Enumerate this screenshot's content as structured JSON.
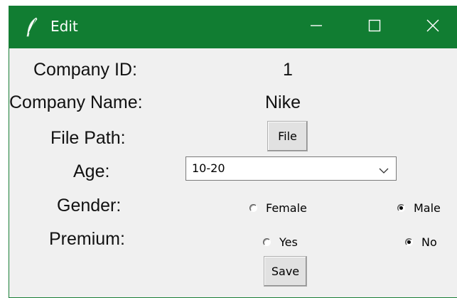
{
  "window": {
    "title": "Edit",
    "icon": "feather-icon",
    "controls": [
      "minimize-icon",
      "maximize-icon",
      "close-icon"
    ]
  },
  "form": {
    "company_id_label": "Company ID:",
    "company_id_value": "1",
    "company_name_label": "Company Name:",
    "company_name_value": "Nike",
    "file_path_label": "File Path:",
    "file_button_label": "File",
    "age_label": "Age:",
    "age_selected": "10-20",
    "gender_label": "Gender:",
    "gender_options": [
      {
        "label": "Female",
        "selected": false
      },
      {
        "label": "Male",
        "selected": true
      }
    ],
    "premium_label": "Premium:",
    "premium_options": [
      {
        "label": "Yes",
        "selected": false
      },
      {
        "label": "No",
        "selected": true
      }
    ],
    "save_button_label": "Save"
  },
  "colors": {
    "titlebar": "#117d32",
    "window_bg": "#f0f0f0"
  }
}
